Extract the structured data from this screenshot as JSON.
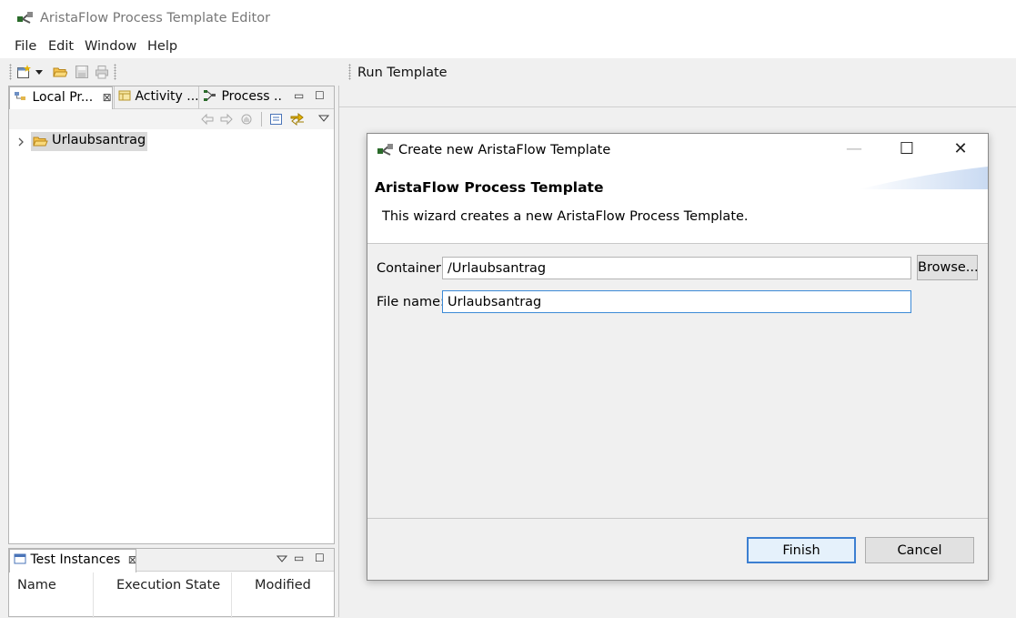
{
  "window": {
    "title": "AristaFlow Process Template Editor"
  },
  "menu": [
    "File",
    "Edit",
    "Window",
    "Help"
  ],
  "toolbar": {
    "run_template": "Run Template"
  },
  "left_view": {
    "tabs": [
      {
        "label": "Local Pr...",
        "close": "⊠"
      },
      {
        "label": "Activity ..."
      },
      {
        "label": "Process ..."
      }
    ],
    "tree": [
      {
        "label": "Urlaubsantrag",
        "expanded": false
      }
    ]
  },
  "bottom_view": {
    "tab": {
      "label": "Test Instances",
      "close": "⊠"
    },
    "columns": [
      "Name",
      "Execution State",
      "Modified"
    ]
  },
  "dialog": {
    "title": "Create new AristaFlow Template",
    "heading": "AristaFlow Process Template",
    "description": "This wizard creates a new AristaFlow Process Template.",
    "container_label": "Container:",
    "container_value": "/Urlaubsantrag",
    "browse_label": "Browse...",
    "filename_label": "File name:",
    "filename_value": "Urlaubsantrag",
    "finish_label": "Finish",
    "cancel_label": "Cancel"
  },
  "colors": {
    "accent": "#3c7fd1",
    "selection": "#dadada"
  }
}
